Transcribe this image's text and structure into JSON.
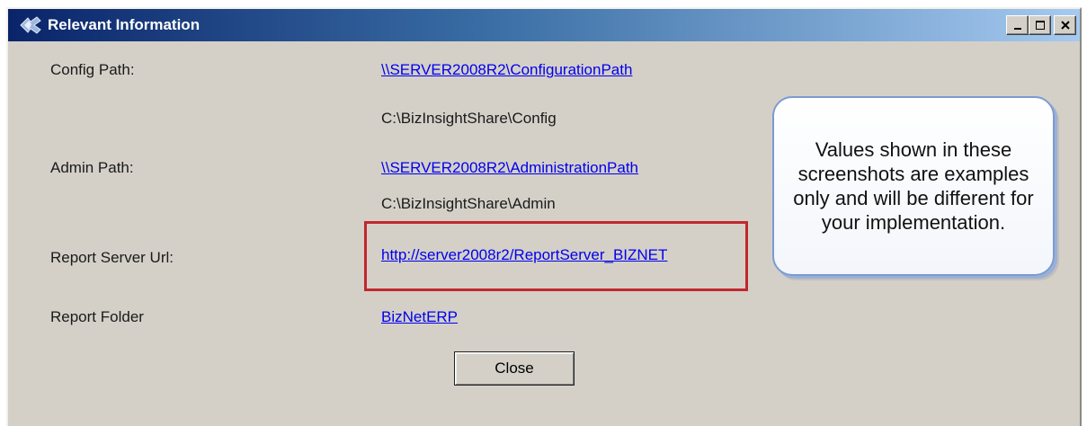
{
  "window": {
    "title": "Relevant Information",
    "title_icon": "app-icon",
    "controls": {
      "minimize_icon": "minimize-icon",
      "maximize_icon": "maximize-icon",
      "close_icon": "close-icon"
    }
  },
  "fields": {
    "config": {
      "label": "Config Path:",
      "link": "\\\\SERVER2008R2\\ConfigurationPath",
      "local": "C:\\BizInsightShare\\Config"
    },
    "admin": {
      "label": "Admin Path:",
      "link": "\\\\SERVER2008R2\\AdministrationPath",
      "local": "C:\\BizInsightShare\\Admin"
    },
    "report_server": {
      "label": "Report Server Url:",
      "link": "http://server2008r2/ReportServer_BIZNET"
    },
    "report_folder": {
      "label": "Report Folder",
      "link": "BizNetERP"
    }
  },
  "callout": {
    "text": "Values shown in these screenshots are examples only and will be different for your implementation."
  },
  "buttons": {
    "close_label": "Close"
  },
  "colors": {
    "titlebar_start": "#0a246a",
    "titlebar_end": "#a6caf0",
    "dialog_bg": "#d4d0c8",
    "link": "#0000ee",
    "highlight": "#c0272d",
    "callout_border": "#7a9bd1"
  }
}
